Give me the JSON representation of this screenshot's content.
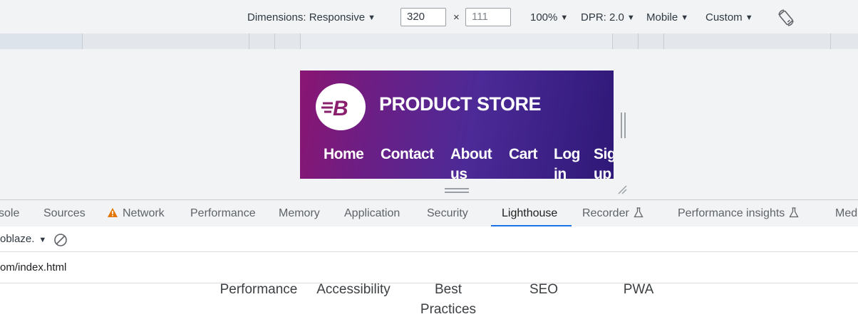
{
  "device_toolbar": {
    "dimensions_label": "Dimensions: Responsive",
    "width_value": "320",
    "times": "×",
    "height_placeholder": "111",
    "zoom": "100%",
    "dpr": "DPR: 2.0",
    "mode": "Mobile",
    "throttle": "Custom",
    "rotate_icon": "rotate-icon"
  },
  "preview": {
    "brand_title": "PRODUCT STORE",
    "logo_letter": "B",
    "nav": [
      "Home",
      "Contact",
      "About us",
      "Cart",
      "Log in",
      "Sign up"
    ],
    "gradient_colors": [
      "#8a1572",
      "#4c2a97",
      "#2e1877"
    ]
  },
  "devtools_tabs": {
    "items": [
      "sole",
      "Sources",
      "Network",
      "Performance",
      "Memory",
      "Application",
      "Security",
      "Lighthouse",
      "Recorder",
      "Performance insights",
      "Med"
    ],
    "active": "Lighthouse",
    "accent": "#1a73e8",
    "warning_color": "#e37400"
  },
  "lighthouse_toolbar": {
    "site": "oblaze.",
    "clear_icon": "block-icon"
  },
  "url": "om/index.html",
  "categories": [
    "Performance",
    "Accessibility",
    "Best Practices",
    "SEO",
    "PWA"
  ]
}
